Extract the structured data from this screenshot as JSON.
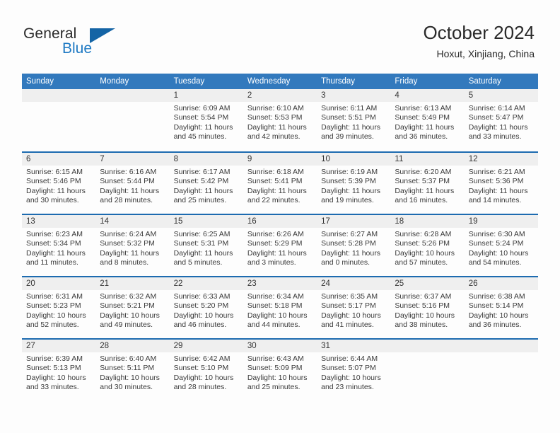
{
  "brand": {
    "general": "General",
    "blue": "Blue",
    "triangle_color": "#1464a5",
    "blue_color": "#1f7ac4"
  },
  "header": {
    "title": "October 2024",
    "subtitle": "Hoxut, Xinjiang, China"
  },
  "theme": {
    "header_bg": "#3279bd",
    "row_border": "#1d6bb0",
    "day_band_bg": "#efefef",
    "page_bg": "#fdfdfd"
  },
  "calendar": {
    "day_headers": [
      "Sunday",
      "Monday",
      "Tuesday",
      "Wednesday",
      "Thursday",
      "Friday",
      "Saturday"
    ],
    "weeks": [
      [
        {
          "day": "",
          "empty": true,
          "sunrise": "",
          "sunset": "",
          "daylight_1": "",
          "daylight_2": ""
        },
        {
          "day": "",
          "empty": true,
          "sunrise": "",
          "sunset": "",
          "daylight_1": "",
          "daylight_2": ""
        },
        {
          "day": "1",
          "sunrise": "Sunrise: 6:09 AM",
          "sunset": "Sunset: 5:54 PM",
          "daylight_1": "Daylight: 11 hours",
          "daylight_2": "and 45 minutes."
        },
        {
          "day": "2",
          "sunrise": "Sunrise: 6:10 AM",
          "sunset": "Sunset: 5:53 PM",
          "daylight_1": "Daylight: 11 hours",
          "daylight_2": "and 42 minutes."
        },
        {
          "day": "3",
          "sunrise": "Sunrise: 6:11 AM",
          "sunset": "Sunset: 5:51 PM",
          "daylight_1": "Daylight: 11 hours",
          "daylight_2": "and 39 minutes."
        },
        {
          "day": "4",
          "sunrise": "Sunrise: 6:13 AM",
          "sunset": "Sunset: 5:49 PM",
          "daylight_1": "Daylight: 11 hours",
          "daylight_2": "and 36 minutes."
        },
        {
          "day": "5",
          "sunrise": "Sunrise: 6:14 AM",
          "sunset": "Sunset: 5:47 PM",
          "daylight_1": "Daylight: 11 hours",
          "daylight_2": "and 33 minutes."
        }
      ],
      [
        {
          "day": "6",
          "sunrise": "Sunrise: 6:15 AM",
          "sunset": "Sunset: 5:46 PM",
          "daylight_1": "Daylight: 11 hours",
          "daylight_2": "and 30 minutes."
        },
        {
          "day": "7",
          "sunrise": "Sunrise: 6:16 AM",
          "sunset": "Sunset: 5:44 PM",
          "daylight_1": "Daylight: 11 hours",
          "daylight_2": "and 28 minutes."
        },
        {
          "day": "8",
          "sunrise": "Sunrise: 6:17 AM",
          "sunset": "Sunset: 5:42 PM",
          "daylight_1": "Daylight: 11 hours",
          "daylight_2": "and 25 minutes."
        },
        {
          "day": "9",
          "sunrise": "Sunrise: 6:18 AM",
          "sunset": "Sunset: 5:41 PM",
          "daylight_1": "Daylight: 11 hours",
          "daylight_2": "and 22 minutes."
        },
        {
          "day": "10",
          "sunrise": "Sunrise: 6:19 AM",
          "sunset": "Sunset: 5:39 PM",
          "daylight_1": "Daylight: 11 hours",
          "daylight_2": "and 19 minutes."
        },
        {
          "day": "11",
          "sunrise": "Sunrise: 6:20 AM",
          "sunset": "Sunset: 5:37 PM",
          "daylight_1": "Daylight: 11 hours",
          "daylight_2": "and 16 minutes."
        },
        {
          "day": "12",
          "sunrise": "Sunrise: 6:21 AM",
          "sunset": "Sunset: 5:36 PM",
          "daylight_1": "Daylight: 11 hours",
          "daylight_2": "and 14 minutes."
        }
      ],
      [
        {
          "day": "13",
          "sunrise": "Sunrise: 6:23 AM",
          "sunset": "Sunset: 5:34 PM",
          "daylight_1": "Daylight: 11 hours",
          "daylight_2": "and 11 minutes."
        },
        {
          "day": "14",
          "sunrise": "Sunrise: 6:24 AM",
          "sunset": "Sunset: 5:32 PM",
          "daylight_1": "Daylight: 11 hours",
          "daylight_2": "and 8 minutes."
        },
        {
          "day": "15",
          "sunrise": "Sunrise: 6:25 AM",
          "sunset": "Sunset: 5:31 PM",
          "daylight_1": "Daylight: 11 hours",
          "daylight_2": "and 5 minutes."
        },
        {
          "day": "16",
          "sunrise": "Sunrise: 6:26 AM",
          "sunset": "Sunset: 5:29 PM",
          "daylight_1": "Daylight: 11 hours",
          "daylight_2": "and 3 minutes."
        },
        {
          "day": "17",
          "sunrise": "Sunrise: 6:27 AM",
          "sunset": "Sunset: 5:28 PM",
          "daylight_1": "Daylight: 11 hours",
          "daylight_2": "and 0 minutes."
        },
        {
          "day": "18",
          "sunrise": "Sunrise: 6:28 AM",
          "sunset": "Sunset: 5:26 PM",
          "daylight_1": "Daylight: 10 hours",
          "daylight_2": "and 57 minutes."
        },
        {
          "day": "19",
          "sunrise": "Sunrise: 6:30 AM",
          "sunset": "Sunset: 5:24 PM",
          "daylight_1": "Daylight: 10 hours",
          "daylight_2": "and 54 minutes."
        }
      ],
      [
        {
          "day": "20",
          "sunrise": "Sunrise: 6:31 AM",
          "sunset": "Sunset: 5:23 PM",
          "daylight_1": "Daylight: 10 hours",
          "daylight_2": "and 52 minutes."
        },
        {
          "day": "21",
          "sunrise": "Sunrise: 6:32 AM",
          "sunset": "Sunset: 5:21 PM",
          "daylight_1": "Daylight: 10 hours",
          "daylight_2": "and 49 minutes."
        },
        {
          "day": "22",
          "sunrise": "Sunrise: 6:33 AM",
          "sunset": "Sunset: 5:20 PM",
          "daylight_1": "Daylight: 10 hours",
          "daylight_2": "and 46 minutes."
        },
        {
          "day": "23",
          "sunrise": "Sunrise: 6:34 AM",
          "sunset": "Sunset: 5:18 PM",
          "daylight_1": "Daylight: 10 hours",
          "daylight_2": "and 44 minutes."
        },
        {
          "day": "24",
          "sunrise": "Sunrise: 6:35 AM",
          "sunset": "Sunset: 5:17 PM",
          "daylight_1": "Daylight: 10 hours",
          "daylight_2": "and 41 minutes."
        },
        {
          "day": "25",
          "sunrise": "Sunrise: 6:37 AM",
          "sunset": "Sunset: 5:16 PM",
          "daylight_1": "Daylight: 10 hours",
          "daylight_2": "and 38 minutes."
        },
        {
          "day": "26",
          "sunrise": "Sunrise: 6:38 AM",
          "sunset": "Sunset: 5:14 PM",
          "daylight_1": "Daylight: 10 hours",
          "daylight_2": "and 36 minutes."
        }
      ],
      [
        {
          "day": "27",
          "sunrise": "Sunrise: 6:39 AM",
          "sunset": "Sunset: 5:13 PM",
          "daylight_1": "Daylight: 10 hours",
          "daylight_2": "and 33 minutes."
        },
        {
          "day": "28",
          "sunrise": "Sunrise: 6:40 AM",
          "sunset": "Sunset: 5:11 PM",
          "daylight_1": "Daylight: 10 hours",
          "daylight_2": "and 30 minutes."
        },
        {
          "day": "29",
          "sunrise": "Sunrise: 6:42 AM",
          "sunset": "Sunset: 5:10 PM",
          "daylight_1": "Daylight: 10 hours",
          "daylight_2": "and 28 minutes."
        },
        {
          "day": "30",
          "sunrise": "Sunrise: 6:43 AM",
          "sunset": "Sunset: 5:09 PM",
          "daylight_1": "Daylight: 10 hours",
          "daylight_2": "and 25 minutes."
        },
        {
          "day": "31",
          "sunrise": "Sunrise: 6:44 AM",
          "sunset": "Sunset: 5:07 PM",
          "daylight_1": "Daylight: 10 hours",
          "daylight_2": "and 23 minutes."
        },
        {
          "day": "",
          "empty": true,
          "sunrise": "",
          "sunset": "",
          "daylight_1": "",
          "daylight_2": ""
        },
        {
          "day": "",
          "empty": true,
          "sunrise": "",
          "sunset": "",
          "daylight_1": "",
          "daylight_2": ""
        }
      ]
    ]
  }
}
